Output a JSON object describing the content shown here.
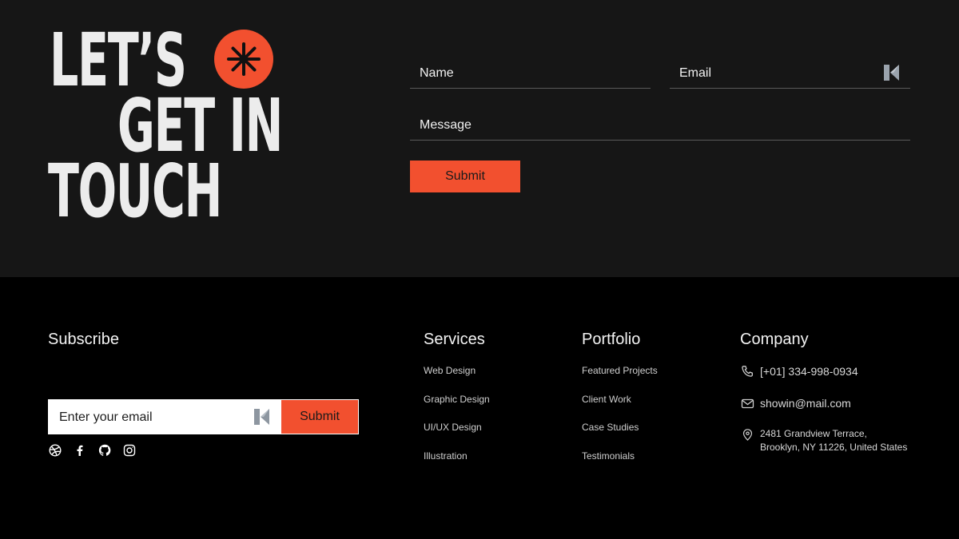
{
  "contact": {
    "headline": [
      "LET’S",
      "GET IN",
      "TOUCH"
    ],
    "fields": {
      "name_label": "Name",
      "email_label": "Email",
      "message_label": "Message"
    },
    "submit_label": "Submit",
    "accent_color": "#f2502f"
  },
  "footer": {
    "subscribe": {
      "title": "Subscribe",
      "placeholder": "Enter your email",
      "button_label": "Submit",
      "social_icons": [
        "dribbble-icon",
        "facebook-icon",
        "github-icon",
        "instagram-icon"
      ]
    },
    "services": {
      "title": "Services",
      "links": [
        "Web Design",
        "Graphic Design",
        "UI/UX Design",
        "Illustration"
      ]
    },
    "portfolio": {
      "title": "Portfolio",
      "links": [
        "Featured Projects",
        "Client Work",
        "Case Studies",
        "Testimonials"
      ]
    },
    "company": {
      "title": "Company",
      "phone": "[+01] 334-998-0934",
      "email": "showin@mail.com",
      "address_line1": "2481 Grandview Terrace,",
      "address_line2": "Brooklyn, NY 11226, United States"
    }
  }
}
